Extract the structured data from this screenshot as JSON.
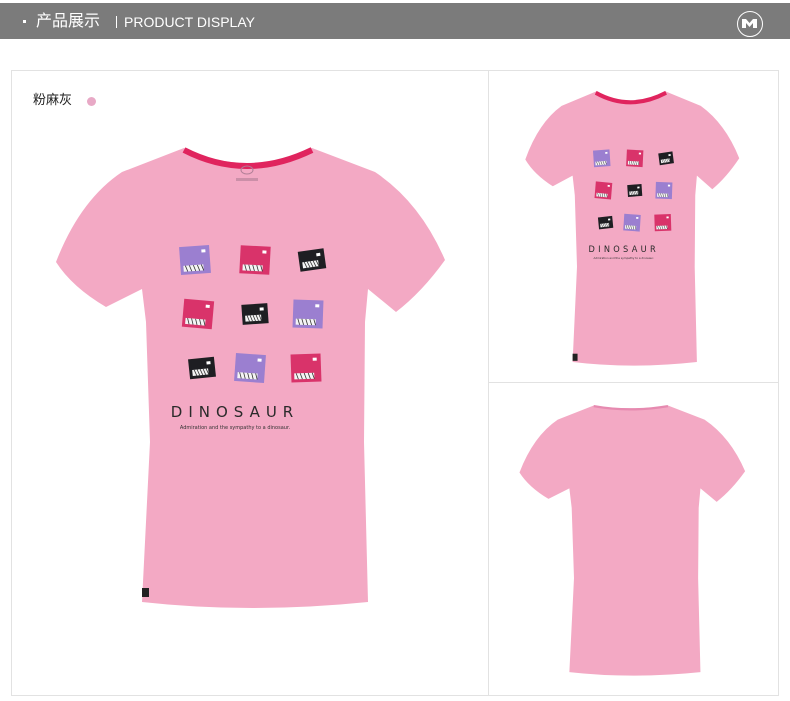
{
  "header": {
    "title_cn": "产品展示",
    "title_en": "PRODUCT DISPLAY",
    "logo_icon": "brand-logo-icon"
  },
  "product": {
    "color_label": "粉麻灰",
    "swatch_color": "#e8a9c6",
    "shirt_color": "#f3a9c4",
    "collar_color": "#e0245e",
    "print_text": "DINOSAUR",
    "print_tagline": "Admiration and the sympathy to a dinosaur.",
    "print_colors": {
      "purple": "#9b7fd0",
      "magenta": "#d9336a",
      "black": "#1e1e22"
    }
  }
}
